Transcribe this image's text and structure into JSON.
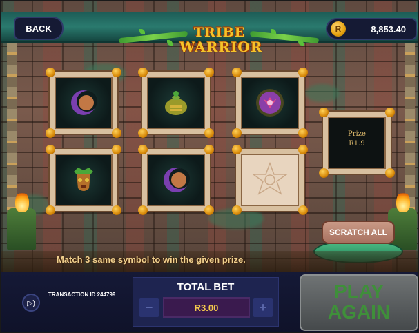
{
  "header": {
    "back_label": "BACK",
    "balance": "8,853.40",
    "currency_symbol": "R",
    "logo_line1": "TRIBE",
    "logo_line2": "WARRIOR"
  },
  "board": {
    "tiles": [
      {
        "symbol": "moon-orb-icon"
      },
      {
        "symbol": "money-bag-icon"
      },
      {
        "symbol": "purple-amulet-icon"
      },
      {
        "symbol": "tribal-mask-icon"
      },
      {
        "symbol": "moon-orb-icon"
      },
      {
        "symbol": "scratched-stone-icon"
      }
    ],
    "prize_line1": "Prize",
    "prize_line2": "R1.9",
    "scratch_all_label": "SCRATCH ALL",
    "rule_text": "Match 3 same symbol to win the given prize."
  },
  "footer": {
    "transaction_label": "TRANSACTION ID 244799",
    "total_bet_label": "TOTAL BET",
    "bet_value": "R3.00",
    "minus_label": "−",
    "plus_label": "+",
    "play_again_line1": "PLAY",
    "play_again_line2": "AGAIN"
  },
  "colors": {
    "accent_gold": "#f4c32a",
    "footer_bg": "#151936",
    "play_text": "#3f8f3a"
  }
}
